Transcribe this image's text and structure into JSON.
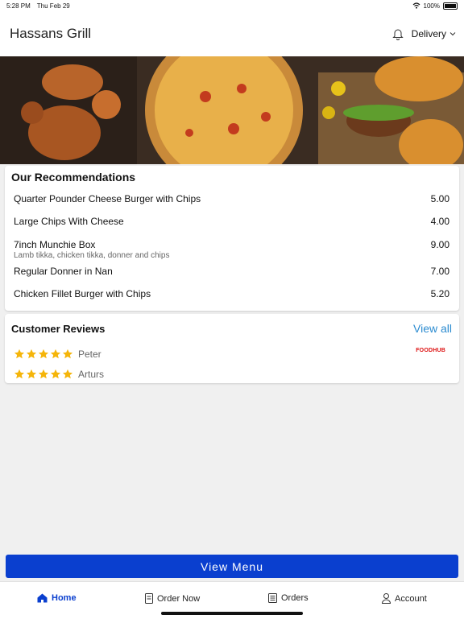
{
  "status": {
    "time": "5:28 PM",
    "date": "Thu Feb 29",
    "battery": "100%"
  },
  "header": {
    "title": "Hassans Grill",
    "mode_label": "Delivery"
  },
  "recommendations": {
    "title": "Our Recommendations",
    "items": [
      {
        "name": "Quarter Pounder Cheese Burger with Chips",
        "price": "5.00"
      },
      {
        "name": "Large Chips With Cheese",
        "price": "4.00"
      },
      {
        "name": "7inch Munchie Box",
        "price": "9.00",
        "description": "Lamb tikka, chicken tikka, donner and chips"
      },
      {
        "name": "Regular Donner in Nan",
        "price": "7.00"
      },
      {
        "name": "Chicken Fillet Burger with Chips",
        "price": "5.20"
      }
    ]
  },
  "reviews": {
    "title": "Customer Reviews",
    "view_all_label": "View all",
    "logo_text": "FOODHUB",
    "items": [
      {
        "name": "Peter",
        "rating": 5
      },
      {
        "name": "Arturs",
        "rating": 5
      }
    ]
  },
  "view_menu_label": "View Menu",
  "tabs": [
    {
      "label": "Home",
      "icon": "home-icon",
      "active": true
    },
    {
      "label": "Order Now",
      "icon": "order-icon",
      "active": false
    },
    {
      "label": "Orders",
      "icon": "receipt-icon",
      "active": false
    },
    {
      "label": "Account",
      "icon": "user-icon",
      "active": false
    }
  ],
  "colors": {
    "accent": "#0a3fcf",
    "link": "#2b8bd0",
    "star": "#f5b50a"
  }
}
